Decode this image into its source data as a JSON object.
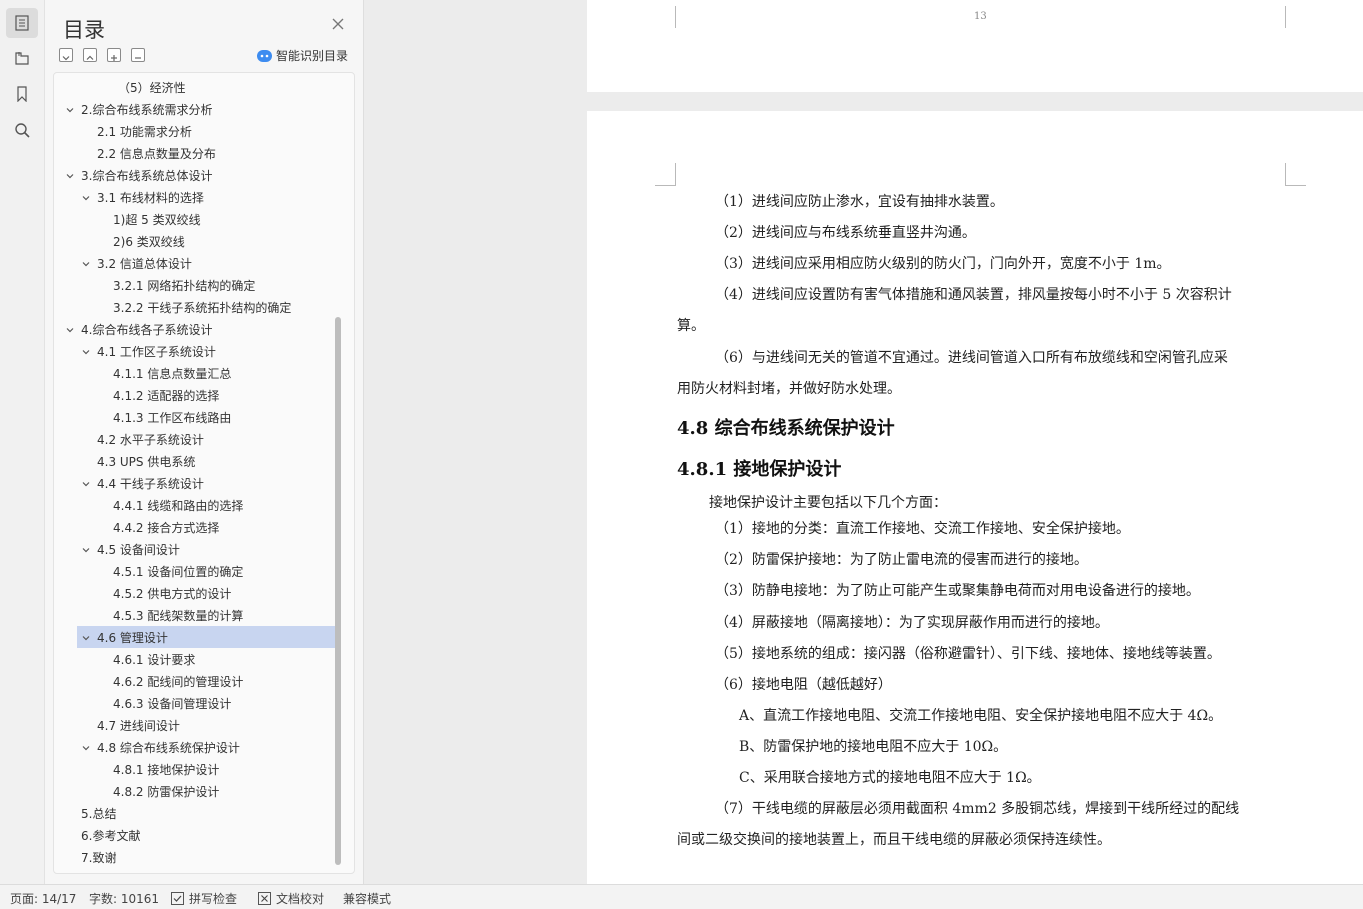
{
  "sidebar_rail": {
    "icons": [
      "outline-icon",
      "pages-icon",
      "bookmark-icon",
      "search-icon"
    ]
  },
  "outline": {
    "title": "目录",
    "smart_label": "智能识别目录",
    "items": [
      {
        "label": "（5）经济性",
        "level": 3,
        "expanded": null
      },
      {
        "label": "2.综合布线系统需求分析",
        "level": 1,
        "expanded": true
      },
      {
        "label": "2.1 功能需求分析",
        "level": 2,
        "expanded": null
      },
      {
        "label": "2.2 信息点数量及分布",
        "level": 2,
        "expanded": null
      },
      {
        "label": "3.综合布线系统总体设计",
        "level": 1,
        "expanded": true
      },
      {
        "label": "3.1 布线材料的选择",
        "level": 2,
        "expanded": true
      },
      {
        "label": "1)超 5 类双绞线",
        "level": 3,
        "expanded": null
      },
      {
        "label": "2)6 类双绞线",
        "level": 3,
        "expanded": null
      },
      {
        "label": "3.2 信道总体设计",
        "level": 2,
        "expanded": true
      },
      {
        "label": "3.2.1 网络拓扑结构的确定",
        "level": 3,
        "expanded": null
      },
      {
        "label": "3.2.2 干线子系统拓扑结构的确定",
        "level": 3,
        "expanded": null
      },
      {
        "label": "4.综合布线各子系统设计",
        "level": 1,
        "expanded": true
      },
      {
        "label": "4.1 工作区子系统设计",
        "level": 2,
        "expanded": true
      },
      {
        "label": "4.1.1 信息点数量汇总",
        "level": 3,
        "expanded": null
      },
      {
        "label": "4.1.2 适配器的选择",
        "level": 3,
        "expanded": null
      },
      {
        "label": "4.1.3 工作区布线路由",
        "level": 3,
        "expanded": null
      },
      {
        "label": "4.2 水平子系统设计",
        "level": 2,
        "expanded": null
      },
      {
        "label": "4.3 UPS 供电系统",
        "level": 2,
        "expanded": null
      },
      {
        "label": "4.4 干线子系统设计",
        "level": 2,
        "expanded": true
      },
      {
        "label": "4.4.1 线缆和路由的选择",
        "level": 3,
        "expanded": null
      },
      {
        "label": "4.4.2 接合方式选择",
        "level": 3,
        "expanded": null
      },
      {
        "label": "4.5 设备间设计",
        "level": 2,
        "expanded": true
      },
      {
        "label": "4.5.1 设备间位置的确定",
        "level": 3,
        "expanded": null
      },
      {
        "label": "4.5.2 供电方式的设计",
        "level": 3,
        "expanded": null
      },
      {
        "label": "4.5.3 配线架数量的计算",
        "level": 3,
        "expanded": null
      },
      {
        "label": "4.6 管理设计",
        "level": 2,
        "expanded": true,
        "selected": true
      },
      {
        "label": "4.6.1 设计要求",
        "level": 3,
        "expanded": null
      },
      {
        "label": "4.6.2 配线间的管理设计",
        "level": 3,
        "expanded": null
      },
      {
        "label": "4.6.3 设备间管理设计",
        "level": 3,
        "expanded": null
      },
      {
        "label": "4.7 进线间设计",
        "level": 2,
        "expanded": null
      },
      {
        "label": "4.8 综合布线系统保护设计",
        "level": 2,
        "expanded": true
      },
      {
        "label": "4.8.1 接地保护设计",
        "level": 3,
        "expanded": null
      },
      {
        "label": "4.8.2 防雷保护设计",
        "level": 3,
        "expanded": null
      },
      {
        "label": "5.总结",
        "level": 1,
        "expanded": null
      },
      {
        "label": "6.参考文献",
        "level": 1,
        "expanded": null
      },
      {
        "label": "7.致谢",
        "level": 1,
        "expanded": null
      }
    ]
  },
  "document": {
    "page_number": "13",
    "lines": [
      "（1）进线间应防止渗水，宜设有抽排水装置。",
      "（2）进线间应与布线系统垂直竖井沟通。",
      "（3）进线间应采用相应防火级别的防火门，门向外开，宽度不小于 1m。",
      "（4）进线间应设置防有害气体措施和通风装置，排风量按每小时不小于 5 次容积计",
      "算。",
      "（6）与进线间无关的管道不宜通过。进线间管道入口所有布放缆线和空闲管孔应采",
      "用防火材料封堵，并做好防水处理。",
      "4.8 综合布线系统保护设计",
      "4.8.1 接地保护设计",
      "接地保护设计主要包括以下几个方面：",
      "（1）接地的分类：直流工作接地、交流工作接地、安全保护接地。",
      "（2）防雷保护接地：为了防止雷电流的侵害而进行的接地。",
      "（3）防静电接地：为了防止可能产生或聚集静电荷而对用电设备进行的接地。",
      "（4）屏蔽接地（隔离接地）：为了实现屏蔽作用而进行的接地。",
      "（5）接地系统的组成：接闪器（俗称避雷针）、引下线、接地体、接地线等装置。",
      "（6）接地电阻（越低越好）",
      "A、直流工作接地电阻、交流工作接地电阻、安全保护接地电阻不应大于 4Ω。",
      "B、防雷保护地的接地电阻不应大于 10Ω。",
      "C、采用联合接地方式的接地电阻不应大于 1Ω。",
      "（7）干线电缆的屏蔽层必须用截面积 4mm2 多股铜芯线，焊接到干线所经过的配线",
      "间或二级交换间的接地装置上，而且干线电缆的屏蔽必须保持连续性。"
    ]
  },
  "status_bar": {
    "page": "页面: 14/17",
    "words": "字数: 10161",
    "spell": "拼写检查",
    "proof": "文档校对",
    "compat": "兼容模式"
  }
}
